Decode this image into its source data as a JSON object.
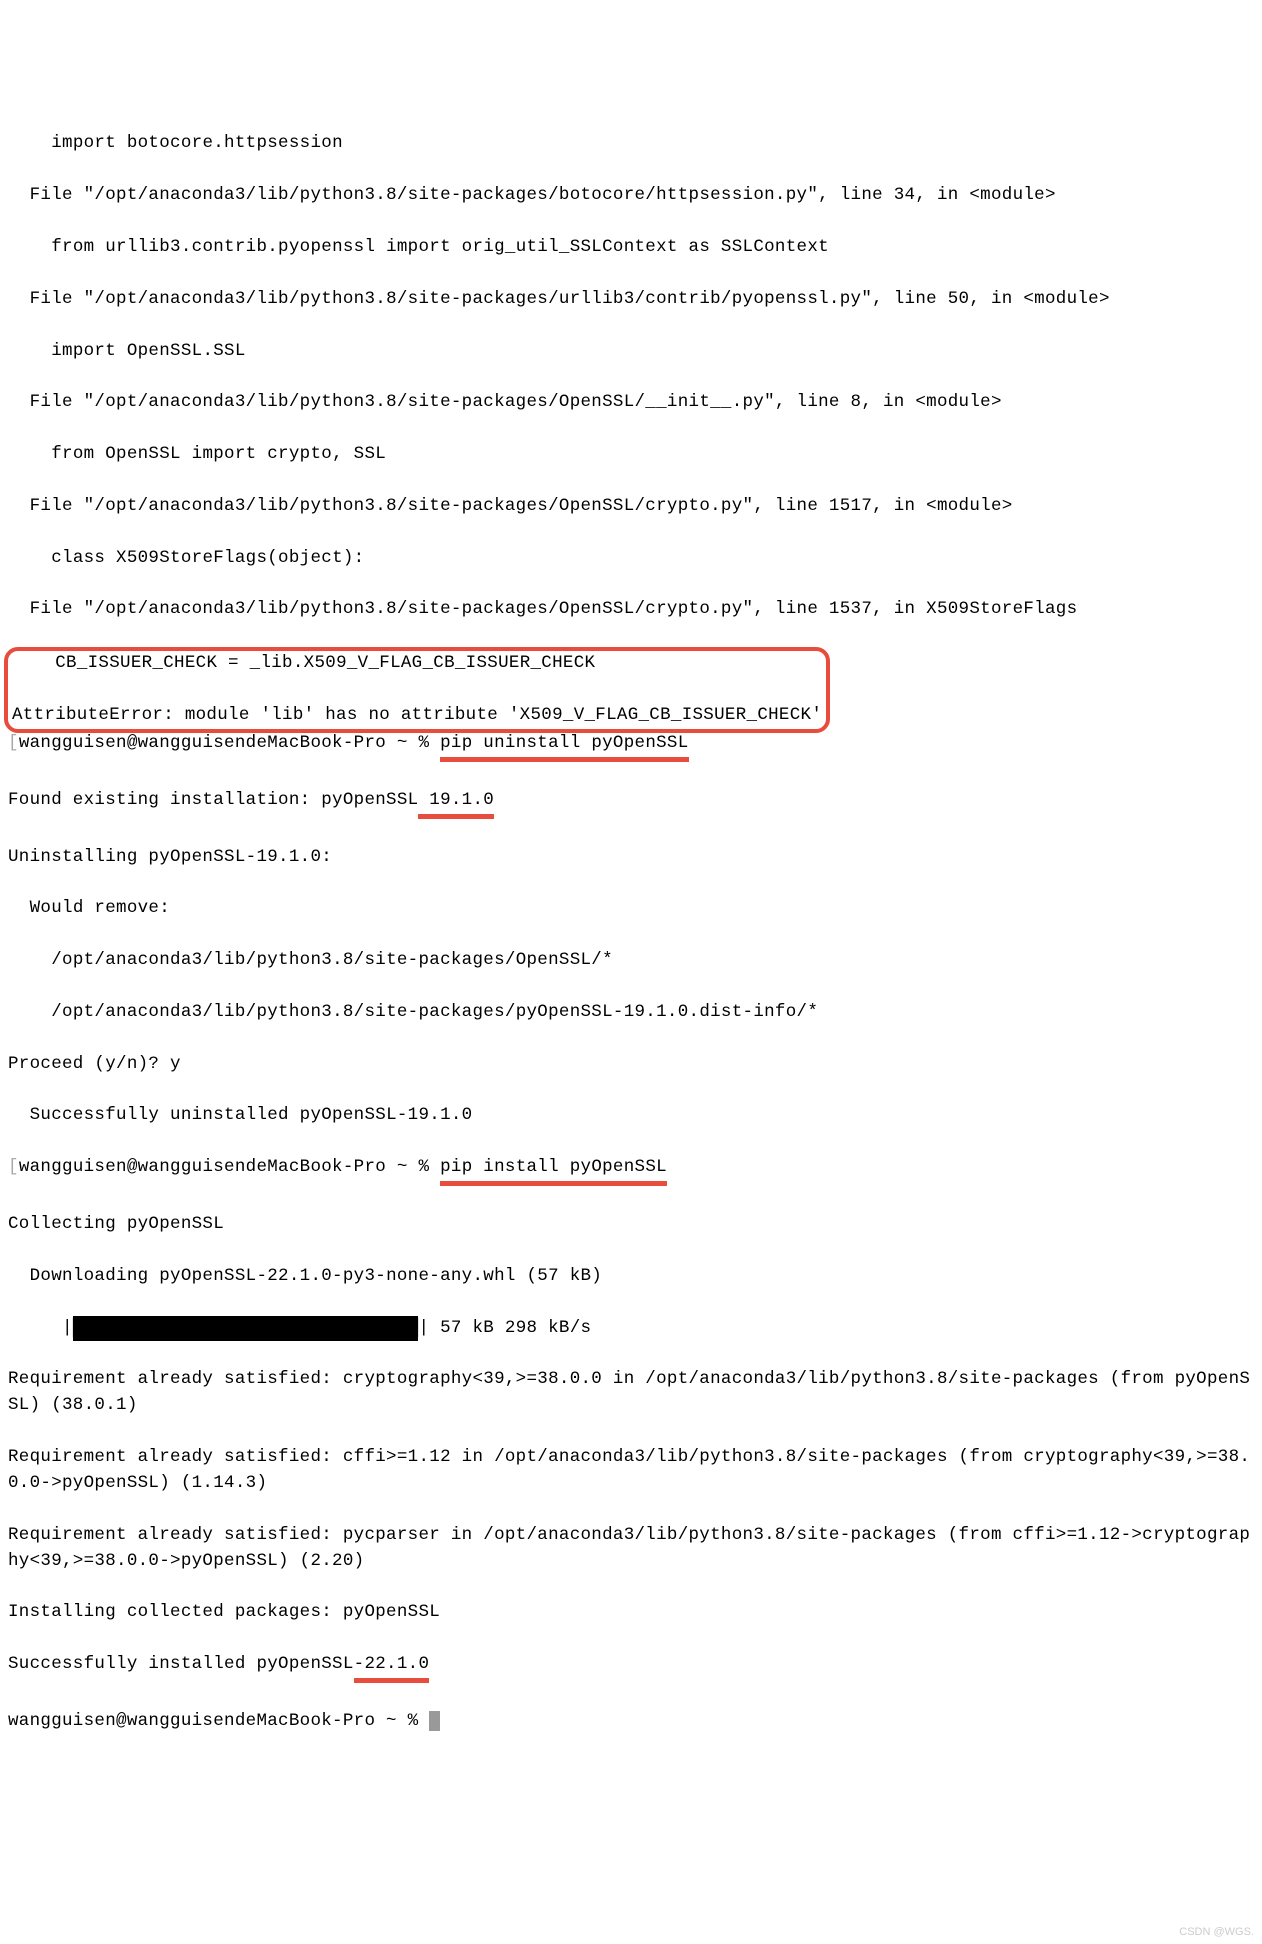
{
  "traceback": {
    "l1": "    import botocore.httpsession",
    "l2": "  File \"/opt/anaconda3/lib/python3.8/site-packages/botocore/httpsession.py\", line 34, in <module>",
    "l3": "    from urllib3.contrib.pyopenssl import orig_util_SSLContext as SSLContext",
    "l4": "  File \"/opt/anaconda3/lib/python3.8/site-packages/urllib3/contrib/pyopenssl.py\", line 50, in <module>",
    "l5": "    import OpenSSL.SSL",
    "l6": "  File \"/opt/anaconda3/lib/python3.8/site-packages/OpenSSL/__init__.py\", line 8, in <module>",
    "l7": "    from OpenSSL import crypto, SSL",
    "l8": "  File \"/opt/anaconda3/lib/python3.8/site-packages/OpenSSL/crypto.py\", line 1517, in <module>",
    "l9": "    class X509StoreFlags(object):",
    "l10": "  File \"/opt/anaconda3/lib/python3.8/site-packages/OpenSSL/crypto.py\", line 1537, in X509StoreFlags"
  },
  "error_box": {
    "l1": "    CB_ISSUER_CHECK = _lib.X509_V_FLAG_CB_ISSUER_CHECK",
    "l2": "AttributeError: module 'lib' has no attribute 'X509_V_FLAG_CB_ISSUER_CHECK'"
  },
  "uninstall": {
    "prompt_prefix": "wangguisen@wangguisendeMacBook-Pro ~ % ",
    "cmd": "pip uninstall pyOpenSSL",
    "found_prefix": "Found existing installation: pyOpenSSL",
    "found_version": " 19.1.0",
    "uninstalling": "Uninstalling pyOpenSSL-19.1.0:",
    "would_remove": "  Would remove:",
    "path1": "    /opt/anaconda3/lib/python3.8/site-packages/OpenSSL/*",
    "path2": "    /opt/anaconda3/lib/python3.8/site-packages/pyOpenSSL-19.1.0.dist-info/*",
    "proceed": "Proceed (y/n)? y",
    "success": "  Successfully uninstalled pyOpenSSL-19.1.0"
  },
  "install": {
    "prompt_prefix": "wangguisen@wangguisendeMacBook-Pro ~ % ",
    "cmd": "pip install pyOpenSSL",
    "collecting": "Collecting pyOpenSSL",
    "downloading": "  Downloading pyOpenSSL-22.1.0-py3-none-any.whl (57 kB)",
    "progress_prefix": "     |",
    "progress_bar": "████████████████████████████████",
    "progress_suffix": "| 57 kB 298 kB/s",
    "req1": "Requirement already satisfied: cryptography<39,>=38.0.0 in /opt/anaconda3/lib/python3.8/site-packages (from pyOpenSSL) (38.0.1)",
    "req2": "Requirement already satisfied: cffi>=1.12 in /opt/anaconda3/lib/python3.8/site-packages (from cryptography<39,>=38.0.0->pyOpenSSL) (1.14.3)",
    "req3": "Requirement already satisfied: pycparser in /opt/anaconda3/lib/python3.8/site-packages (from cffi>=1.12->cryptography<39,>=38.0.0->pyOpenSSL) (2.20)",
    "installing": "Installing collected packages: pyOpenSSL",
    "success_prefix": "Successfully installed pyOpenSSL",
    "success_version": "-22.1.0"
  },
  "final_prompt": "wangguisen@wangguisendeMacBook-Pro ~ % ",
  "watermark": "CSDN @WGS."
}
